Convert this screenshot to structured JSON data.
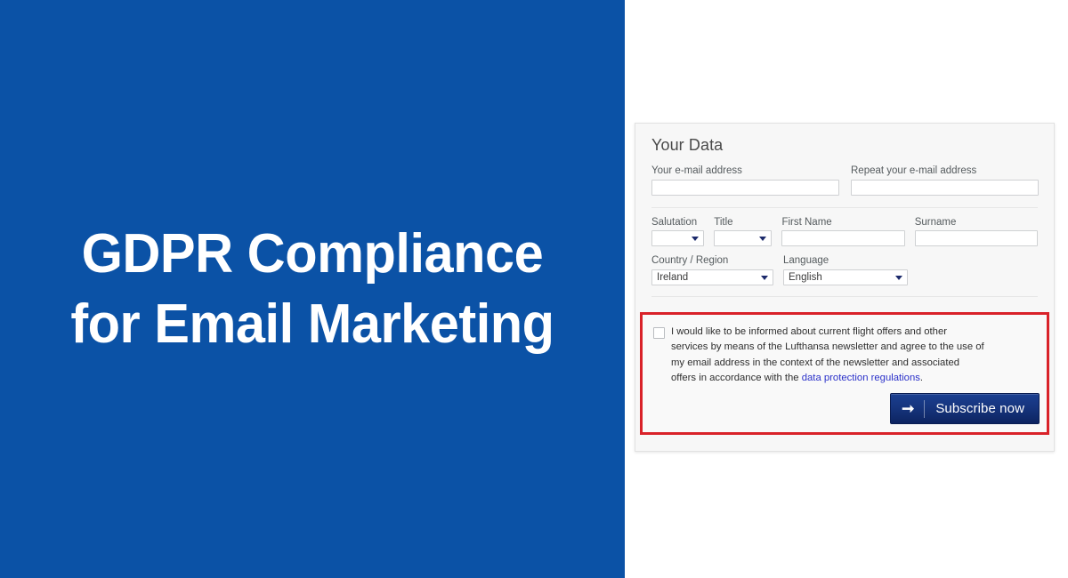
{
  "hero": {
    "title": "GDPR Compliance\nfor Email Marketing",
    "background_color": "#0b52a6",
    "text_color": "#ffffff"
  },
  "form_card": {
    "heading": "Your Data",
    "email_row": {
      "email_label": "Your e-mail address",
      "email_value": "",
      "email_placeholder": "",
      "repeat_label": "Repeat your e-mail address",
      "repeat_value": "",
      "repeat_placeholder": ""
    },
    "name_row": {
      "salutation_label": "Salutation",
      "salutation_value": "",
      "title_label": "Title",
      "title_value": "",
      "first_name_label": "First Name",
      "first_name_value": "",
      "surname_label": "Surname",
      "surname_value": ""
    },
    "locale_row": {
      "country_label": "Country / Region",
      "country_value": "Ireland",
      "language_label": "Language",
      "language_value": "English"
    },
    "consent": {
      "highlight_color": "#d92229",
      "checkbox_checked": false,
      "text_before_link": "I would like to be informed about current flight offers and other services by means of the Lufthansa newsletter and agree to the use of my email address in the context of the newsletter and associated offers in accordance with the ",
      "link_text": "data protection regulations",
      "link_color": "#2b31c9",
      "text_after_link": ".",
      "submit": {
        "arrow_icon": "arrow-right-icon",
        "label": "Subscribe now",
        "background_color": "#16357e"
      }
    }
  }
}
